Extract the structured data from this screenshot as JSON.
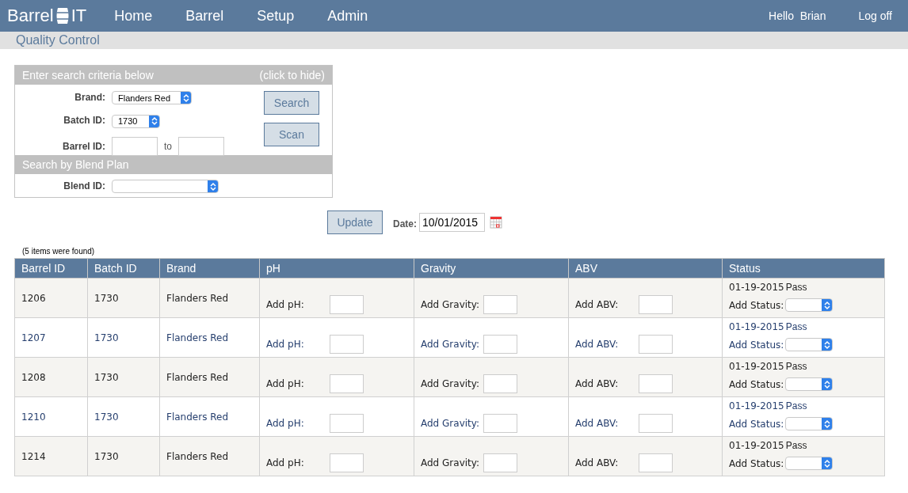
{
  "logo": {
    "text_left": "Barrel",
    "text_right": "IT"
  },
  "nav": [
    "Home",
    "Barrel",
    "Setup",
    "Admin"
  ],
  "user": {
    "greeting": "Hello",
    "name": "Brian",
    "logout": "Log off"
  },
  "page_title": "Quality Control",
  "search_panel": {
    "title": "Enter search criteria below",
    "toggle": "(click to hide)",
    "brand": {
      "label": "Brand:",
      "value": "Flanders Red"
    },
    "batch": {
      "label": "Batch ID:",
      "value": "1730"
    },
    "barrel": {
      "label": "Barrel ID:",
      "separator": "to"
    },
    "buttons": [
      "Search",
      "Scan"
    ],
    "blend_title": "Search by Blend Plan",
    "blend": {
      "label": "Blend ID:"
    }
  },
  "update_button": "Update",
  "date": {
    "label": "Date:",
    "value": "10/01/2015"
  },
  "result_count": "(5 items were found)",
  "table": {
    "columns": [
      "Barrel ID",
      "Batch ID",
      "Brand",
      "pH",
      "Gravity",
      "ABV",
      "Status"
    ],
    "rows": [
      {
        "barrel_id": "1206",
        "batch_id": "1730",
        "brand": "Flanders Red",
        "ph_label": "Add pH:",
        "gravity_label": "Add Gravity:",
        "abv_label": "Add ABV:",
        "status_date": "01-19-2015",
        "status": "Pass",
        "status_label": "Add Status:"
      },
      {
        "barrel_id": "1207",
        "batch_id": "1730",
        "brand": "Flanders Red",
        "ph_label": "Add pH:",
        "gravity_label": "Add Gravity:",
        "abv_label": "Add ABV:",
        "status_date": "01-19-2015",
        "status": "Pass",
        "status_label": "Add Status:"
      },
      {
        "barrel_id": "1208",
        "batch_id": "1730",
        "brand": "Flanders Red",
        "ph_label": "Add pH:",
        "gravity_label": "Add Gravity:",
        "abv_label": "Add ABV:",
        "status_date": "01-19-2015",
        "status": "Pass",
        "status_label": "Add Status:"
      },
      {
        "barrel_id": "1210",
        "batch_id": "1730",
        "brand": "Flanders Red",
        "ph_label": "Add pH:",
        "gravity_label": "Add Gravity:",
        "abv_label": "Add ABV:",
        "status_date": "01-19-2015",
        "status": "Pass",
        "status_label": "Add Status:"
      },
      {
        "barrel_id": "1214",
        "batch_id": "1730",
        "brand": "Flanders Red",
        "ph_label": "Add pH:",
        "gravity_label": "Add Gravity:",
        "abv_label": "Add ABV:",
        "status_date": "01-19-2015",
        "status": "Pass",
        "status_label": "Add Status:"
      }
    ]
  }
}
